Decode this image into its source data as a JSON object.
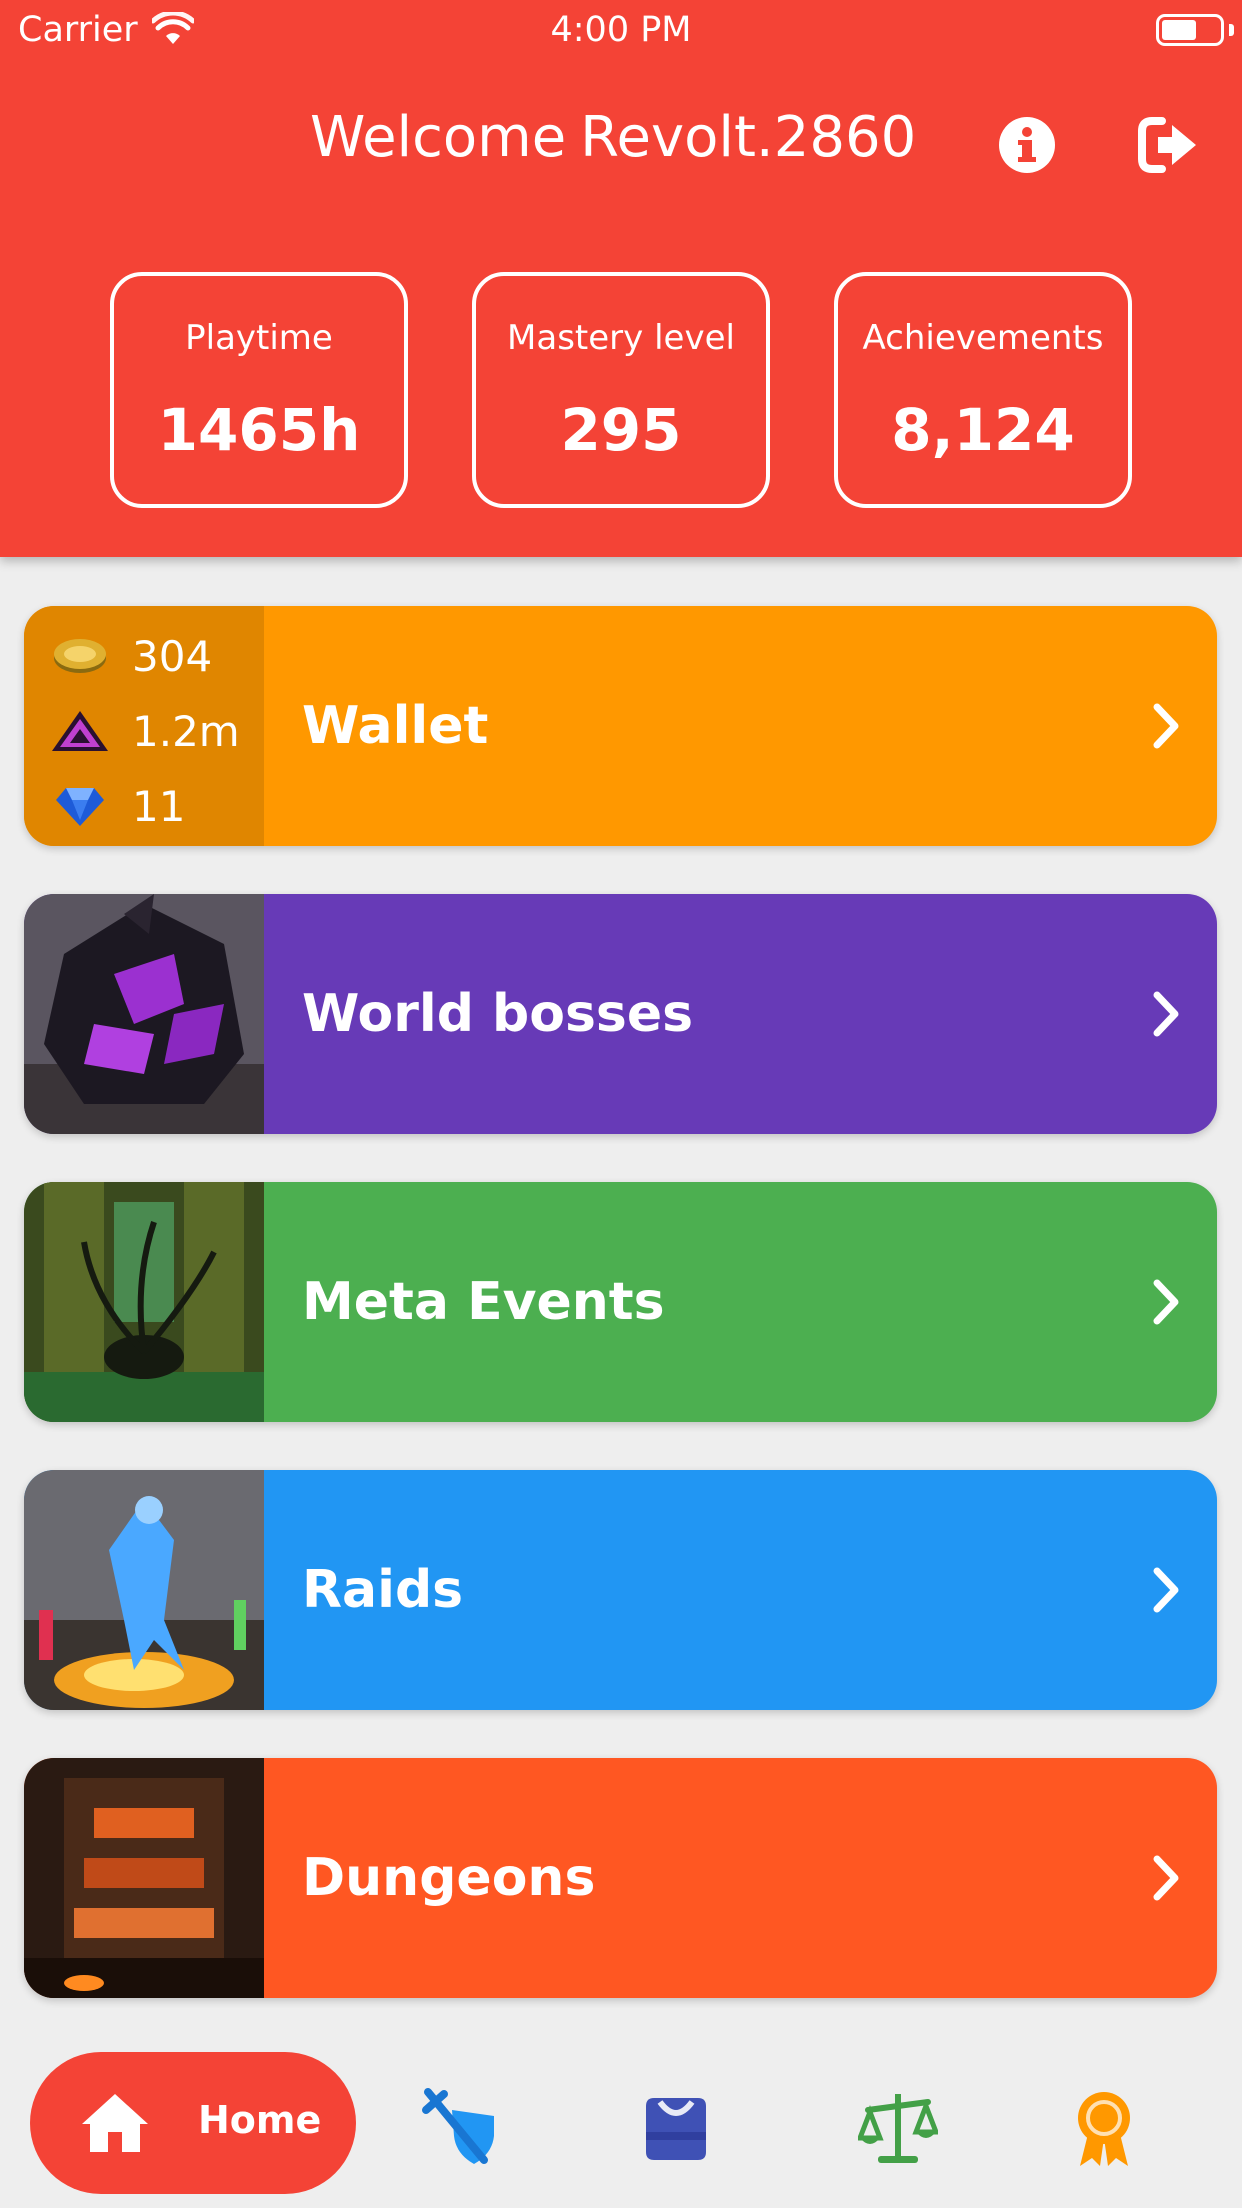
{
  "status_bar": {
    "carrier": "Carrier",
    "time": "4:00 PM"
  },
  "header": {
    "welcome": "Welcome",
    "username": "Revolt.2860",
    "stats": [
      {
        "label": "Playtime",
        "value": "1465h"
      },
      {
        "label": "Mastery level",
        "value": "295"
      },
      {
        "label": "Achievements",
        "value": "8,124"
      }
    ]
  },
  "wallet": {
    "title": "Wallet",
    "currencies": [
      {
        "icon": "gold-coin-icon",
        "amount": "304"
      },
      {
        "icon": "karma-icon",
        "amount": "1.2m"
      },
      {
        "icon": "gem-icon",
        "amount": "11"
      }
    ],
    "color": "#ff9800",
    "side_color": "#e08600"
  },
  "cards": [
    {
      "title": "World bosses",
      "color": "#673ab7"
    },
    {
      "title": "Meta Events",
      "color": "#4caf50"
    },
    {
      "title": "Raids",
      "color": "#2196f3"
    },
    {
      "title": "Dungeons",
      "color": "#ff5722"
    }
  ],
  "bottom_nav": {
    "home_label": "Home",
    "items": [
      "home-icon",
      "pvp-sword-shield-icon",
      "bag-icon",
      "trading-scales-icon",
      "achievement-ribbon-icon"
    ]
  }
}
